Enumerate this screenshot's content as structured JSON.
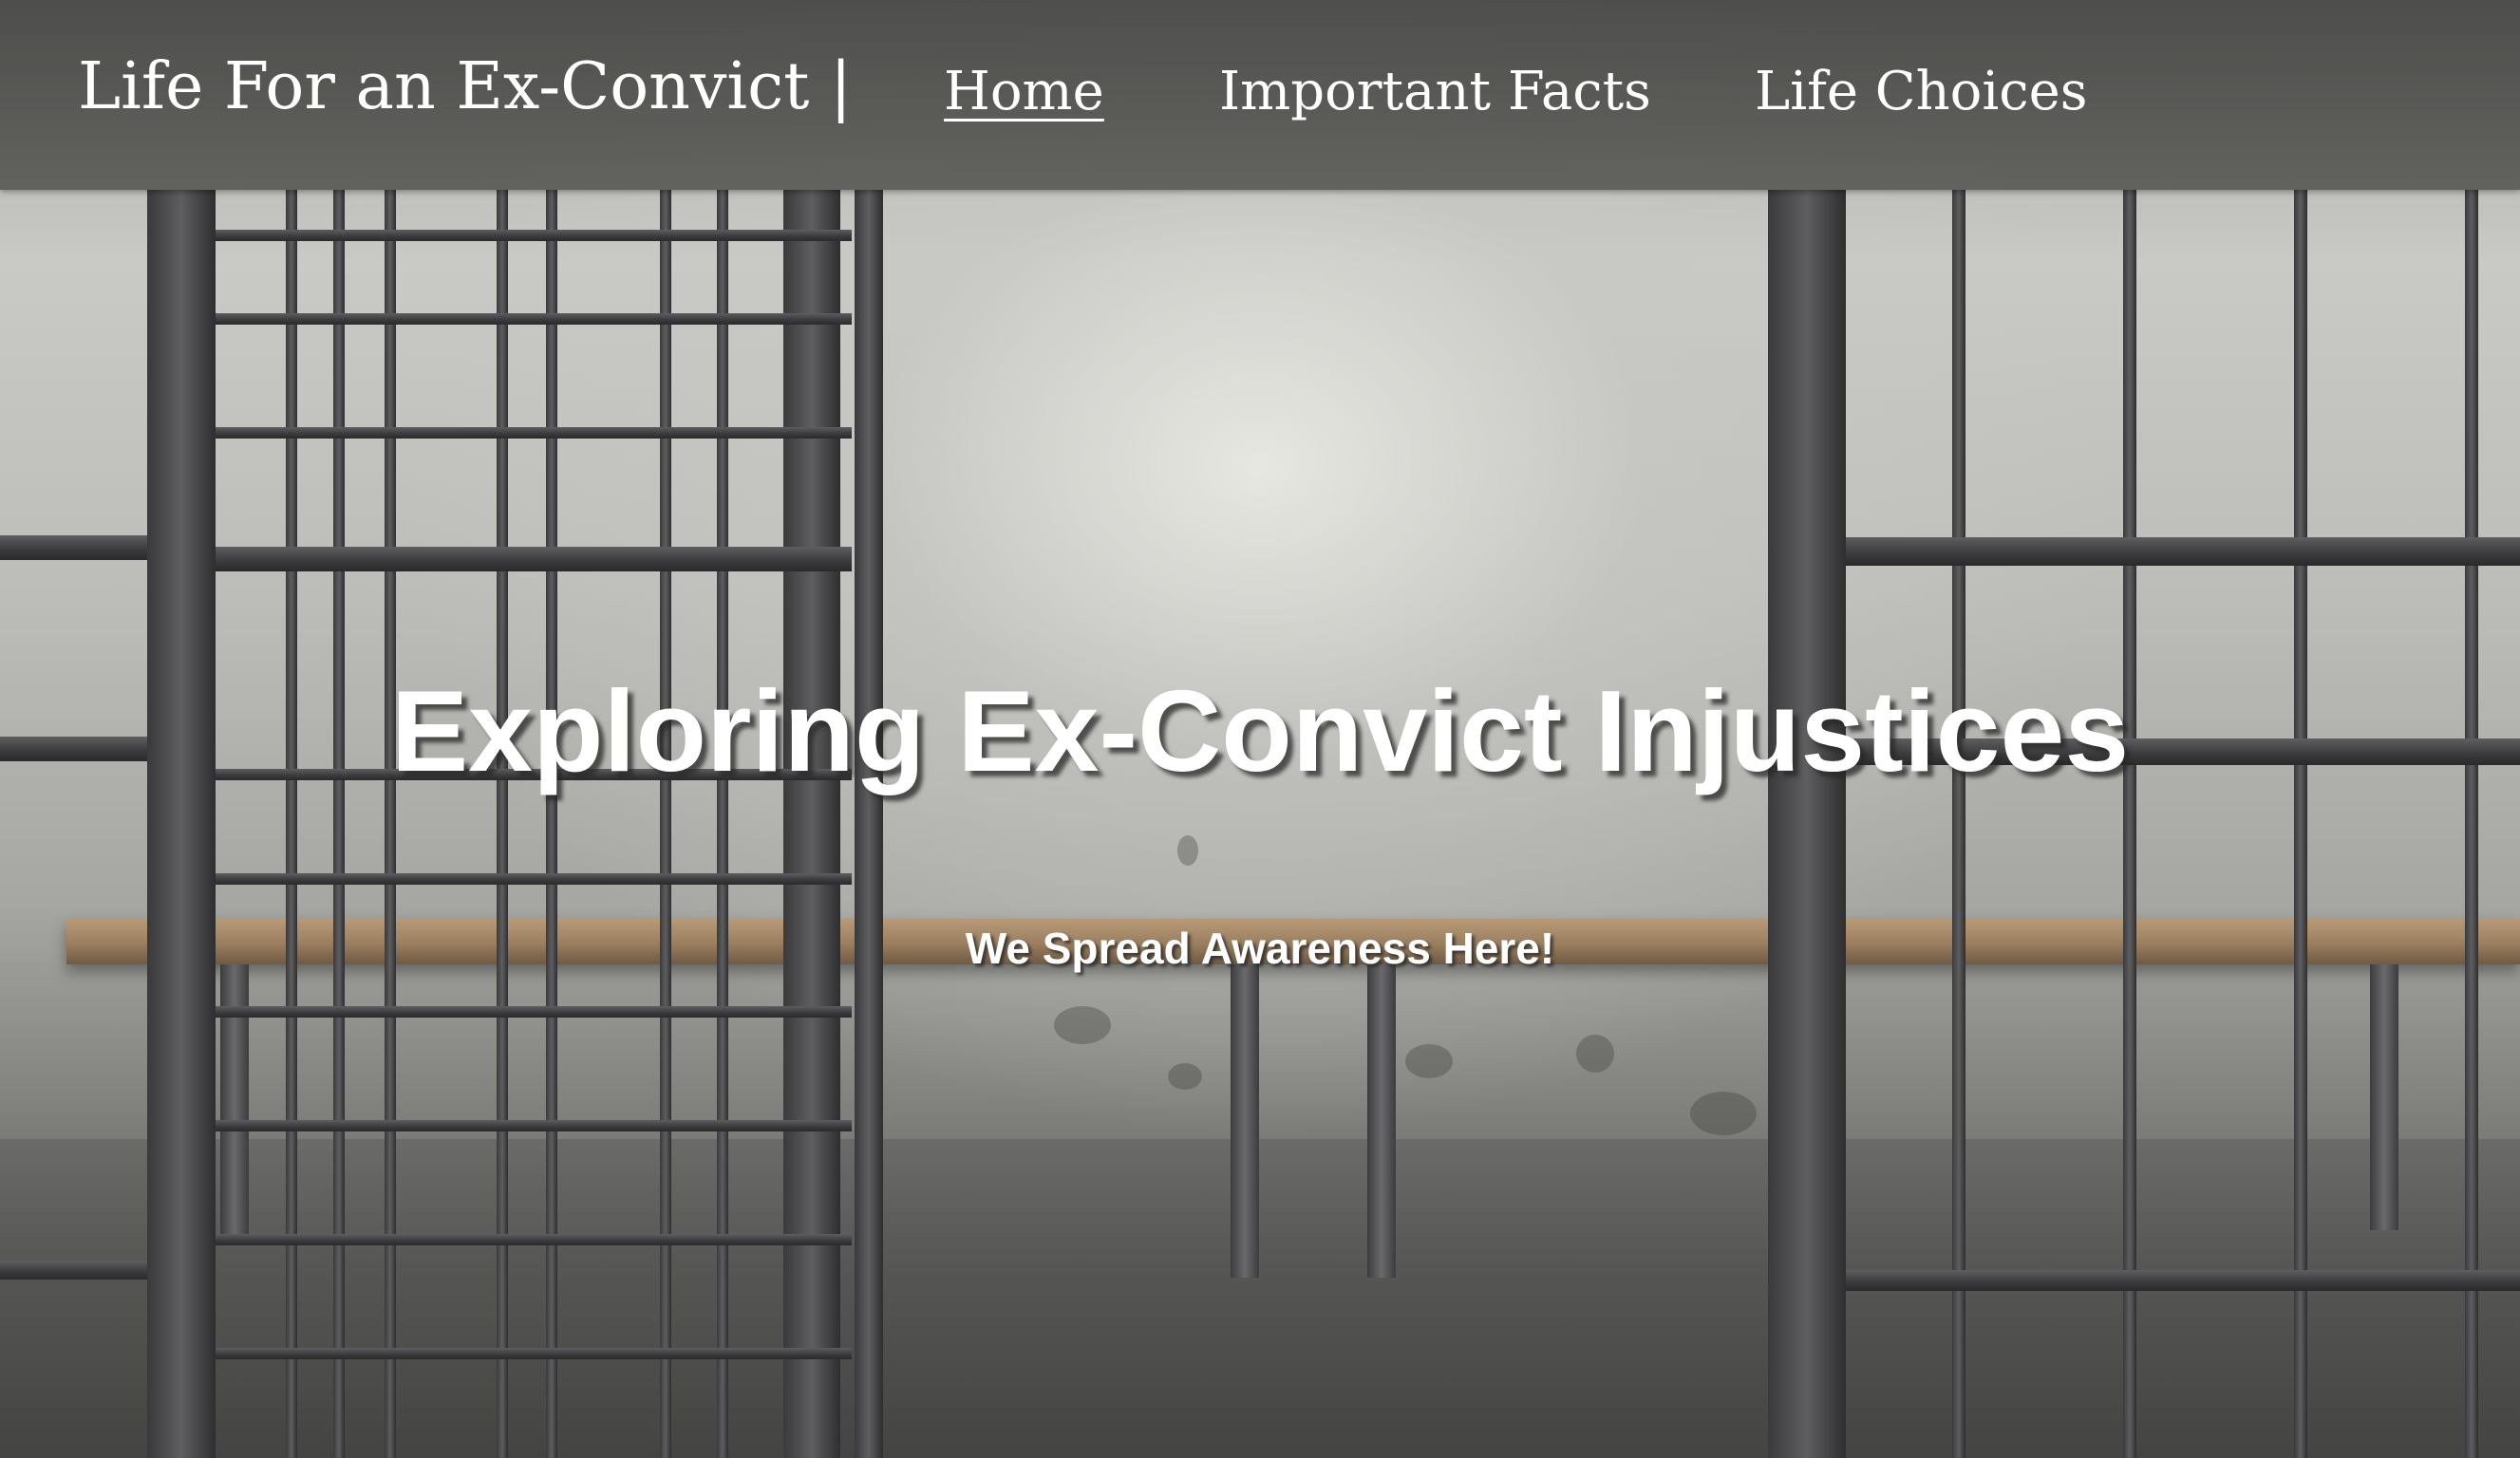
{
  "header": {
    "brand": "Life For an Ex-Convict |",
    "nav": [
      {
        "label": "Home",
        "active": true
      },
      {
        "label": "Important Facts",
        "active": false
      },
      {
        "label": "Life Choices",
        "active": false
      }
    ]
  },
  "hero": {
    "title": "Exploring Ex-Convict Injustices",
    "subtitle": "We Spread Awareness Here!",
    "background_description_icon": "prison-cell-background"
  },
  "colors": {
    "header_bg": "#4a4a48",
    "text": "#ffffff"
  }
}
